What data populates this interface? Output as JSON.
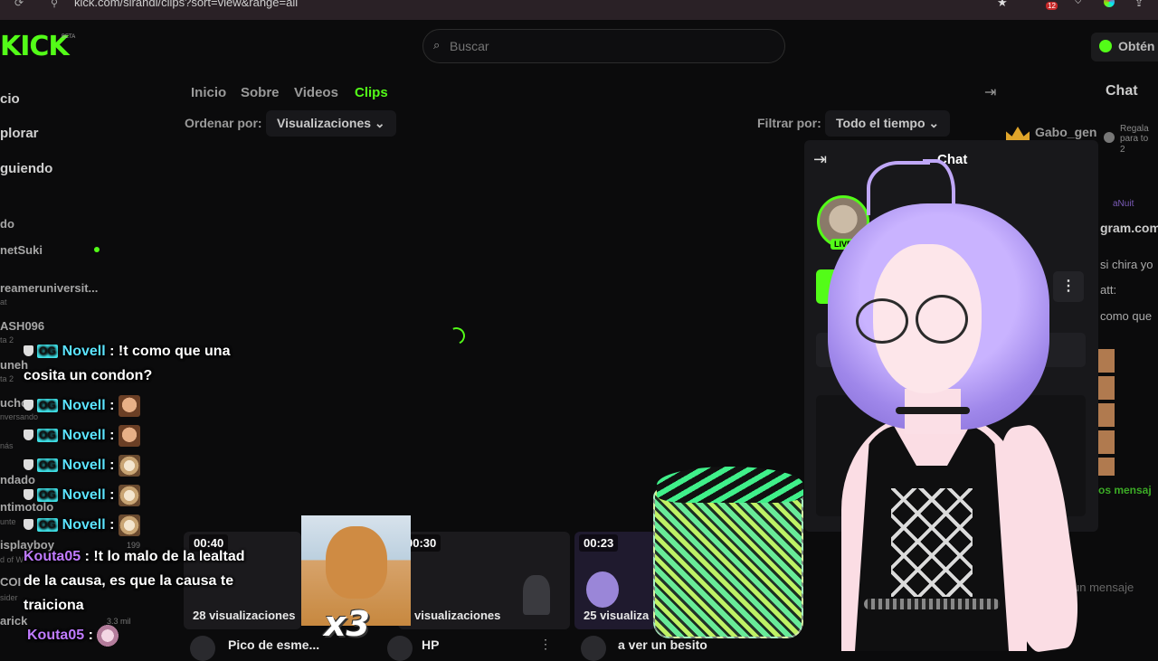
{
  "browser": {
    "url": "kick.com/sirandi/clips?sort=view&range=all",
    "ext_badge": "12"
  },
  "header": {
    "logo": "KICK",
    "beta": "BETA",
    "search_placeholder": "Buscar",
    "get_label": "Obtén"
  },
  "sidebar": {
    "nav": [
      "cio",
      "plorar",
      "guiendo"
    ],
    "section": "do",
    "channels": [
      {
        "name": "netSuki",
        "sub": ""
      },
      {
        "name": "reameruniversit...",
        "sub": "at"
      },
      {
        "name": "ASH096",
        "sub": "ta 2"
      },
      {
        "name": "uneh",
        "sub": "ta 2"
      },
      {
        "name": "ucho",
        "sub": "nversando"
      },
      {
        "name": "nás",
        "sub": ""
      },
      {
        "name": "ndado",
        "sub": ""
      },
      {
        "name": "ntimotolo",
        "sub": "unte"
      },
      {
        "name": "isplayboy",
        "sub": "d of W"
      },
      {
        "name": "COI",
        "sub": "sider"
      },
      {
        "name": "arick",
        "sub": ""
      }
    ]
  },
  "tabs": [
    {
      "label": "Inicio"
    },
    {
      "label": "Sobre"
    },
    {
      "label": "Videos"
    },
    {
      "label": "Clips"
    }
  ],
  "filters": {
    "sort_label": "Ordenar por:",
    "sort_value": "Visualizaciones",
    "filter_label": "Filtrar por:",
    "filter_value": "Todo el tiempo"
  },
  "right_chat": {
    "title": "Chat",
    "user": "Gabo_gen",
    "gift": "Regala para to",
    "gift_num": "2",
    "lines": [
      "aNuit",
      "gram.com/",
      "si chira yo",
      "att:",
      "como que",
      "os mensaj",
      "un mensaje"
    ]
  },
  "popup": {
    "title": "Chat",
    "live": "LIVE"
  },
  "clips": [
    {
      "duration": "00:40",
      "views": "28 visualizaciones",
      "title": "Pico de esme..."
    },
    {
      "duration": "00:30",
      "views": "visualizaciones",
      "title": "HP"
    },
    {
      "duration": "00:23",
      "views": "25 visualiza",
      "title": "a ver un besito"
    }
  ],
  "overlay_chat": [
    {
      "user": "Novell",
      "text": ": !t como que una cosita un condon?"
    },
    {
      "user": "Novell",
      "text": ":"
    },
    {
      "user": "Novell",
      "text": ":"
    },
    {
      "user": "Novell",
      "text": ":"
    },
    {
      "user": "Novell",
      "text": ":"
    },
    {
      "user": "Novell",
      "text": ":"
    },
    {
      "user": "Kouta05",
      "text": ": !t lo malo de la lealtad de la causa, es que la causa te traiciona"
    },
    {
      "user": "Kouta05",
      "text": ":"
    }
  ],
  "badge_text": "OG",
  "x3": "x3",
  "misc": {
    "s199": "199",
    "s33": "3.3 mil"
  }
}
